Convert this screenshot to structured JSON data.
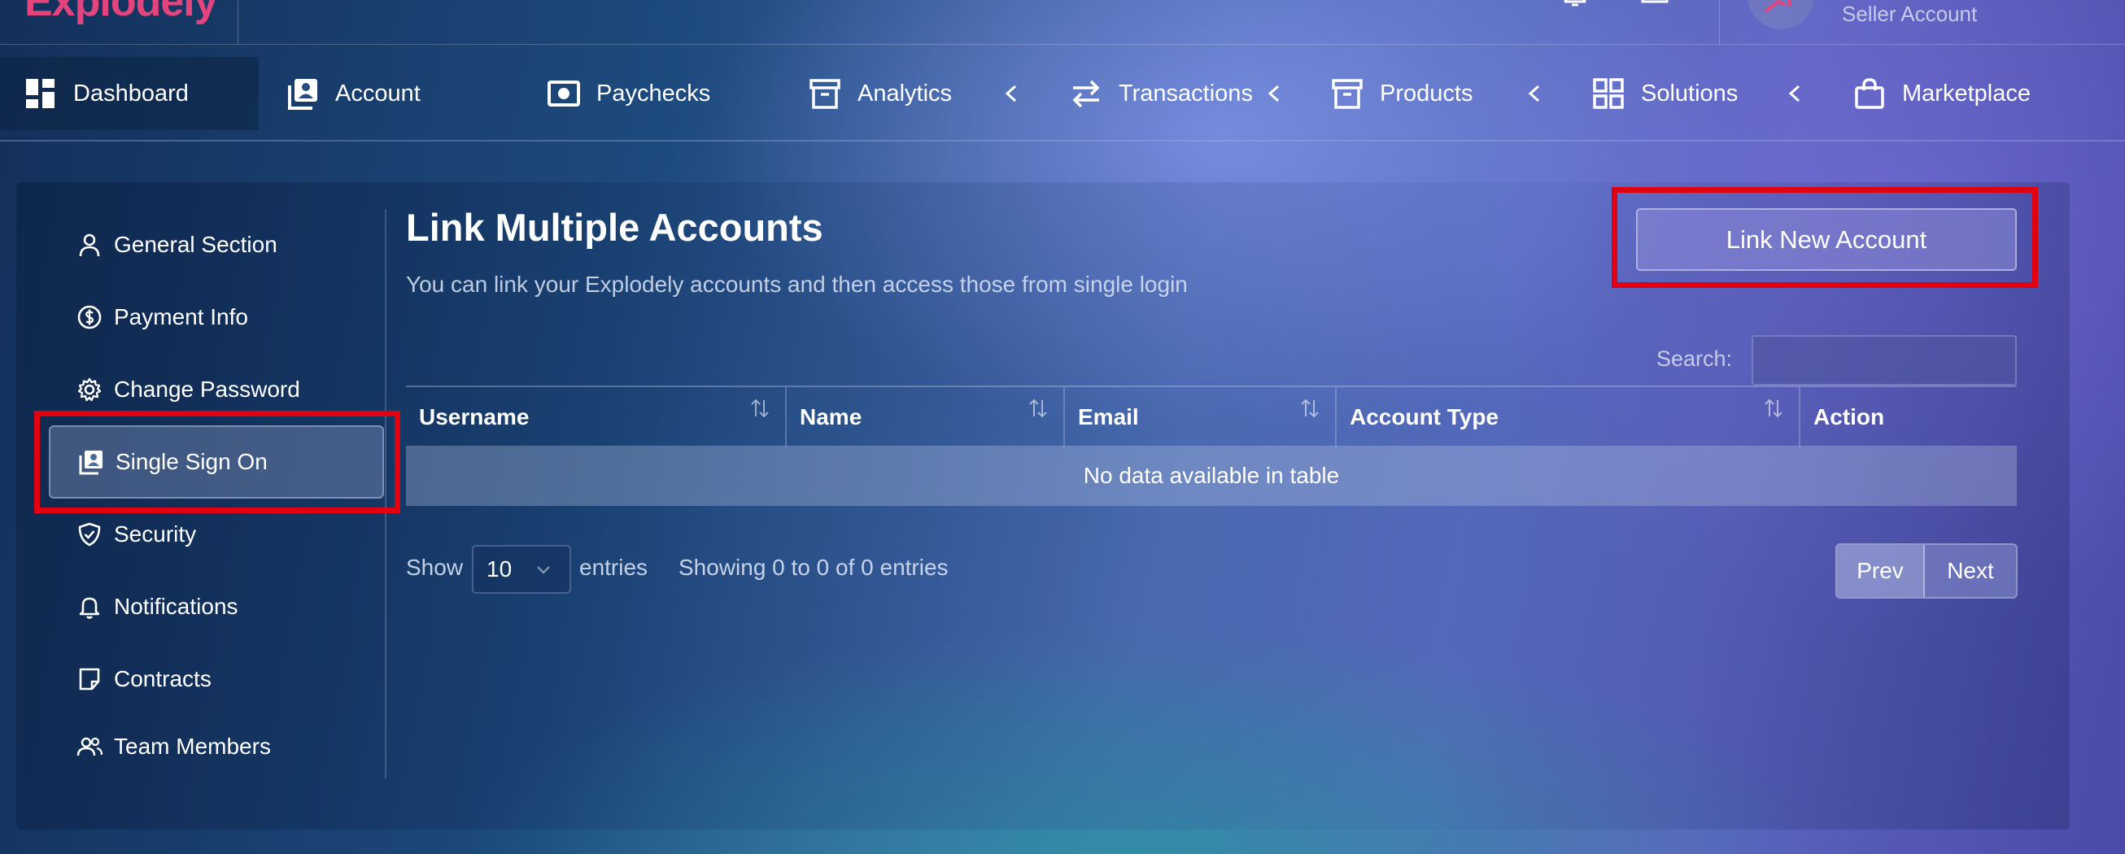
{
  "brand": {
    "logo_text": "Explodely",
    "accent": "#e2447e"
  },
  "header": {
    "user_role": "Seller Account"
  },
  "nav": {
    "items": [
      {
        "label": "Dashboard",
        "icon": "dashboard-icon"
      },
      {
        "label": "Account",
        "icon": "account-icon"
      },
      {
        "label": "Paychecks",
        "icon": "paycheck-icon"
      },
      {
        "label": "Analytics",
        "icon": "archive-icon"
      },
      {
        "label": "Transactions",
        "icon": "transfer-icon"
      },
      {
        "label": "Products",
        "icon": "box-icon"
      },
      {
        "label": "Solutions",
        "icon": "grid-icon"
      },
      {
        "label": "Marketplace",
        "icon": "bag-icon"
      }
    ],
    "active": "Dashboard"
  },
  "sidebar": {
    "items": [
      {
        "label": "General Section",
        "icon": "user-icon"
      },
      {
        "label": "Payment Info",
        "icon": "dollar-icon"
      },
      {
        "label": "Change Password",
        "icon": "gear-icon"
      },
      {
        "label": "Single Sign On",
        "icon": "id-card-icon"
      },
      {
        "label": "Security",
        "icon": "shield-icon"
      },
      {
        "label": "Notifications",
        "icon": "bell-icon"
      },
      {
        "label": "Contracts",
        "icon": "note-icon"
      },
      {
        "label": "Team Members",
        "icon": "users-icon"
      }
    ],
    "active": "Single Sign On"
  },
  "main": {
    "title": "Link Multiple Accounts",
    "subtitle": "You can link your Explodely accounts and then access those from single login",
    "link_button": "Link New Account",
    "search_label": "Search:",
    "search_value": ""
  },
  "table": {
    "columns": [
      "Username",
      "Name",
      "Email",
      "Account Type",
      "Action"
    ],
    "empty_message": "No data available in table"
  },
  "footer": {
    "show_label": "Show",
    "page_size": "10",
    "entries_label": "entries",
    "info": "Showing 0 to 0 of 0 entries",
    "prev": "Prev",
    "next": "Next"
  },
  "colors": {
    "highlight": "#e0000f"
  }
}
